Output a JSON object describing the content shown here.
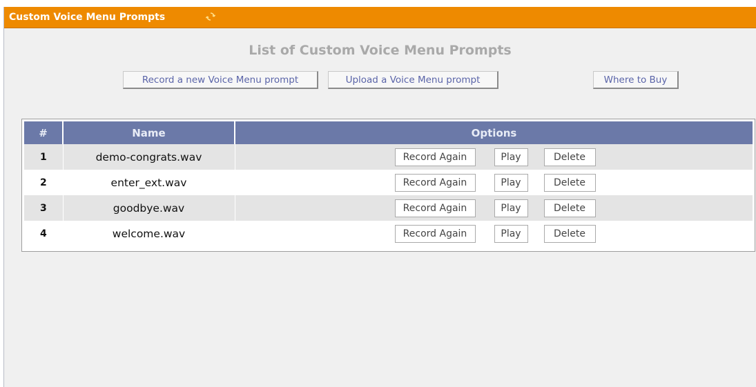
{
  "panel": {
    "title": "Custom Voice Menu Prompts",
    "heading": "List of Custom Voice Menu Prompts"
  },
  "toolbar": {
    "record_new_label": "Record a new Voice Menu prompt",
    "upload_label": "Upload a Voice Menu prompt",
    "where_to_buy_label": "Where to Buy"
  },
  "table": {
    "columns": [
      "#",
      "Name",
      "Options"
    ],
    "rows": [
      {
        "num": "1",
        "name": "demo-congrats.wav"
      },
      {
        "num": "2",
        "name": "enter_ext.wav"
      },
      {
        "num": "3",
        "name": "goodbye.wav"
      },
      {
        "num": "4",
        "name": "welcome.wav"
      }
    ],
    "actions": {
      "record_again": "Record Again",
      "play": "Play",
      "delete": "Delete"
    }
  },
  "colors": {
    "title_bar": "#ee8a00",
    "header_row": "#6b79a8",
    "button_text": "#5a64a8"
  },
  "icons": {
    "refresh": "refresh-icon"
  }
}
